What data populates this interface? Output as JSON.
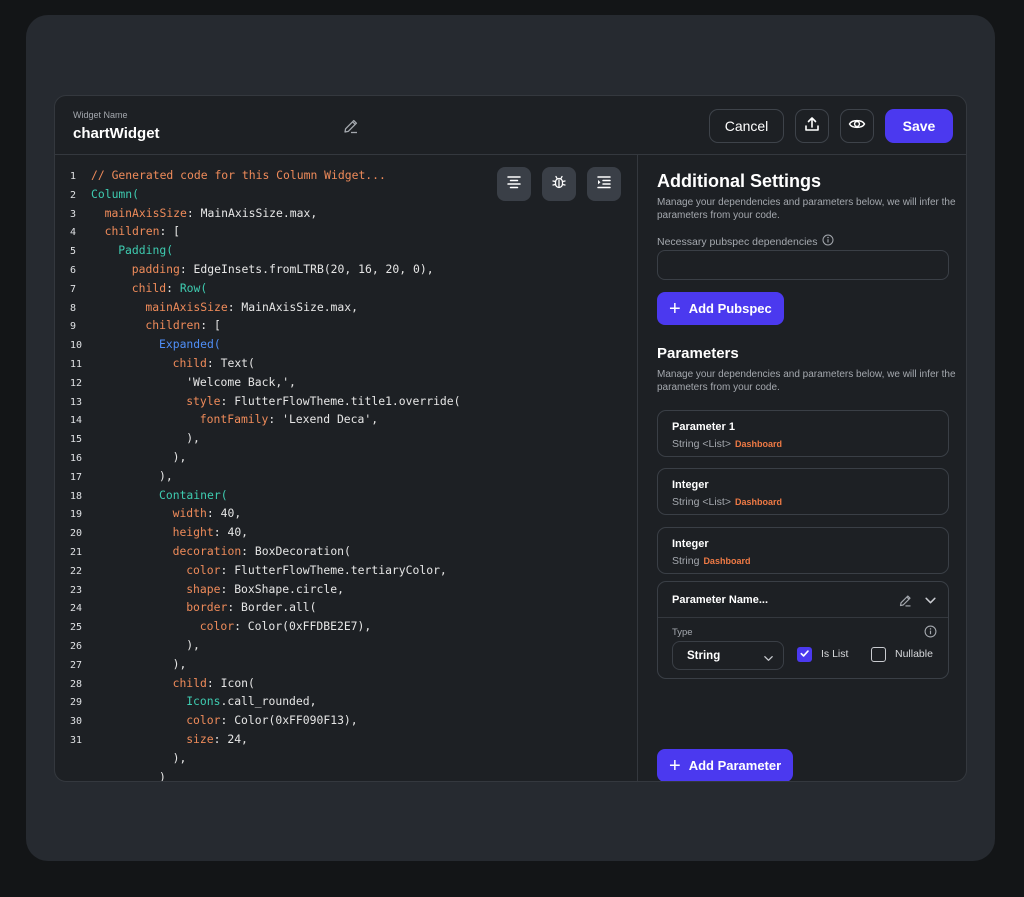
{
  "header": {
    "widget_name_label": "Widget Name",
    "widget_name_value": "chartWidget",
    "cancel_label": "Cancel",
    "save_label": "Save"
  },
  "code": {
    "lines": [
      {
        "n": "1",
        "indent": 0,
        "parts": [
          {
            "t": "// Generated code for this Column Widget...",
            "c": "c-comment"
          }
        ]
      },
      {
        "n": "2",
        "indent": 0,
        "parts": [
          {
            "t": "Column(",
            "c": "c-type"
          }
        ]
      },
      {
        "n": "3",
        "indent": 1,
        "parts": [
          {
            "t": "mainAxisSize",
            "c": "c-prop"
          },
          {
            "t": ": MainAxisSize.max,",
            "c": "c-default"
          }
        ]
      },
      {
        "n": "4",
        "indent": 1,
        "parts": [
          {
            "t": "children",
            "c": "c-prop"
          },
          {
            "t": ": [",
            "c": "c-default"
          }
        ]
      },
      {
        "n": "5",
        "indent": 2,
        "parts": [
          {
            "t": "Padding(",
            "c": "c-type"
          }
        ]
      },
      {
        "n": "6",
        "indent": 3,
        "parts": [
          {
            "t": "padding",
            "c": "c-prop"
          },
          {
            "t": ": EdgeInsets.fromLTRB(20, 16, 20, 0),",
            "c": "c-default"
          }
        ]
      },
      {
        "n": "7",
        "indent": 3,
        "parts": [
          {
            "t": "child",
            "c": "c-prop"
          },
          {
            "t": ": ",
            "c": "c-default"
          },
          {
            "t": "Row(",
            "c": "c-type"
          }
        ]
      },
      {
        "n": "8",
        "indent": 4,
        "parts": [
          {
            "t": "mainAxisSize",
            "c": "c-prop"
          },
          {
            "t": ": MainAxisSize.max,",
            "c": "c-default"
          }
        ]
      },
      {
        "n": "9",
        "indent": 4,
        "parts": [
          {
            "t": "children",
            "c": "c-prop"
          },
          {
            "t": ": [",
            "c": "c-default"
          }
        ]
      },
      {
        "n": "10",
        "indent": 5,
        "parts": [
          {
            "t": "Expanded(",
            "c": "c-blue"
          }
        ]
      },
      {
        "n": "11",
        "indent": 6,
        "parts": [
          {
            "t": "child",
            "c": "c-prop"
          },
          {
            "t": ": Text(",
            "c": "c-default"
          }
        ]
      },
      {
        "n": "12",
        "indent": 7,
        "parts": [
          {
            "t": "'Welcome Back,',",
            "c": "c-default"
          }
        ]
      },
      {
        "n": "13",
        "indent": 7,
        "parts": [
          {
            "t": "style",
            "c": "c-prop"
          },
          {
            "t": ": FlutterFlowTheme.title1.override(",
            "c": "c-default"
          }
        ]
      },
      {
        "n": "14",
        "indent": 8,
        "parts": [
          {
            "t": "fontFamily",
            "c": "c-prop"
          },
          {
            "t": ": 'Lexend Deca',",
            "c": "c-default"
          }
        ]
      },
      {
        "n": "15",
        "indent": 7,
        "parts": [
          {
            "t": "),",
            "c": "c-default"
          }
        ]
      },
      {
        "n": "16",
        "indent": 6,
        "parts": [
          {
            "t": "),",
            "c": "c-default"
          }
        ]
      },
      {
        "n": "17",
        "indent": 5,
        "parts": [
          {
            "t": "),",
            "c": "c-default"
          }
        ]
      },
      {
        "n": "18",
        "indent": 5,
        "parts": [
          {
            "t": "Container(",
            "c": "c-type"
          }
        ]
      },
      {
        "n": "19",
        "indent": 6,
        "parts": [
          {
            "t": "width",
            "c": "c-prop"
          },
          {
            "t": ": 40,",
            "c": "c-default"
          }
        ]
      },
      {
        "n": "20",
        "indent": 6,
        "parts": [
          {
            "t": "height",
            "c": "c-prop"
          },
          {
            "t": ": 40,",
            "c": "c-default"
          }
        ]
      },
      {
        "n": "21",
        "indent": 6,
        "parts": [
          {
            "t": "decoration",
            "c": "c-prop"
          },
          {
            "t": ": BoxDecoration(",
            "c": "c-default"
          }
        ]
      },
      {
        "n": "22",
        "indent": 7,
        "parts": [
          {
            "t": "color",
            "c": "c-prop"
          },
          {
            "t": ": FlutterFlowTheme.tertiaryColor,",
            "c": "c-default"
          }
        ]
      },
      {
        "n": "23",
        "indent": 7,
        "parts": [
          {
            "t": "shape",
            "c": "c-prop"
          },
          {
            "t": ": BoxShape.circle,",
            "c": "c-default"
          }
        ]
      },
      {
        "n": "24",
        "indent": 7,
        "parts": [
          {
            "t": "border",
            "c": "c-prop"
          },
          {
            "t": ": Border.all(",
            "c": "c-default"
          }
        ]
      },
      {
        "n": "25",
        "indent": 8,
        "parts": [
          {
            "t": "color",
            "c": "c-prop"
          },
          {
            "t": ": Color(0xFFDBE2E7),",
            "c": "c-default"
          }
        ]
      },
      {
        "n": "26",
        "indent": 7,
        "parts": [
          {
            "t": "),",
            "c": "c-default"
          }
        ]
      },
      {
        "n": "27",
        "indent": 6,
        "parts": [
          {
            "t": "),",
            "c": "c-default"
          }
        ]
      },
      {
        "n": "28",
        "indent": 6,
        "parts": [
          {
            "t": "child",
            "c": "c-prop"
          },
          {
            "t": ": Icon(",
            "c": "c-default"
          }
        ]
      },
      {
        "n": "29",
        "indent": 7,
        "parts": [
          {
            "t": "Icons",
            "c": "c-type"
          },
          {
            "t": ".call_rounded,",
            "c": "c-default"
          }
        ]
      },
      {
        "n": "30",
        "indent": 7,
        "parts": [
          {
            "t": "color",
            "c": "c-prop"
          },
          {
            "t": ": Color(0xFF090F13),",
            "c": "c-default"
          }
        ]
      },
      {
        "n": "31",
        "indent": 7,
        "parts": [
          {
            "t": "size",
            "c": "c-prop"
          },
          {
            "t": ": 24,",
            "c": "c-default"
          }
        ]
      },
      {
        "n": "",
        "indent": 6,
        "parts": [
          {
            "t": "),",
            "c": "c-default"
          }
        ]
      },
      {
        "n": "",
        "indent": 5,
        "parts": [
          {
            "t": ")",
            "c": "c-default"
          }
        ]
      }
    ]
  },
  "settings": {
    "title": "Additional Settings",
    "desc": "Manage your dependencies and parameters below, we will infer the parameters from your code.",
    "pubspec_label": "Necessary pubspec dependencies",
    "add_pubspec_label": "Add Pubspec",
    "parameters_title": "Parameters",
    "parameters_desc": "Manage your dependencies and parameters below, we will infer the parameters from your code.",
    "params": [
      {
        "name": "Parameter 1",
        "type": "String <List>",
        "badge": "Dashboard"
      },
      {
        "name": "Integer",
        "type": "String <List>",
        "badge": "Dashboard"
      },
      {
        "name": "Integer",
        "type": "String",
        "badge": "Dashboard"
      }
    ],
    "edit": {
      "name": "Parameter Name...",
      "type_label": "Type",
      "type_value": "String",
      "is_list_label": "Is List",
      "nullable_label": "Nullable",
      "is_list": true,
      "nullable": false
    },
    "add_parameter_label": "Add Parameter"
  },
  "colors": {
    "accent": "#4b39ef",
    "badge": "#ef7a45"
  }
}
